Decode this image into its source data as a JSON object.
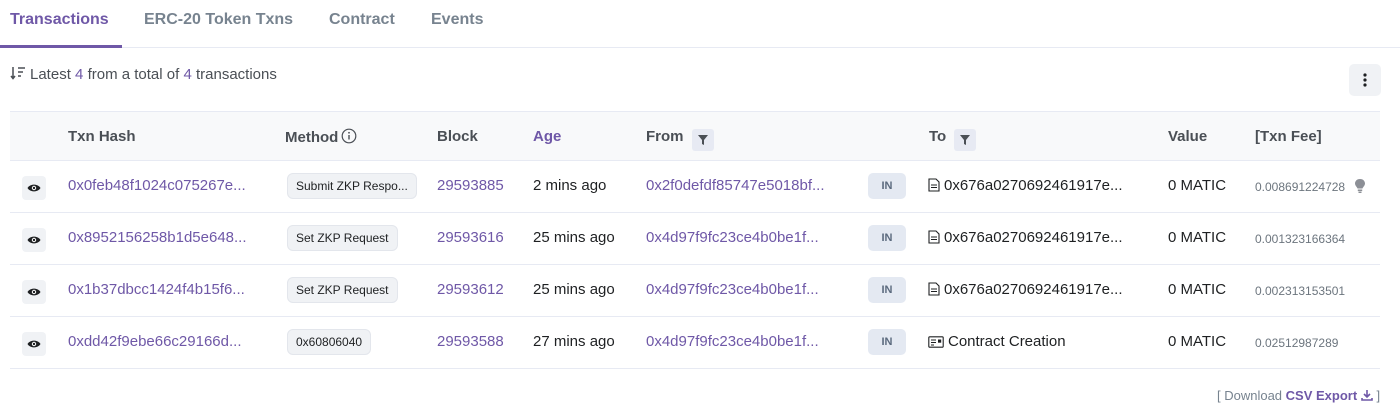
{
  "tabs": [
    {
      "label": "Transactions",
      "active": true
    },
    {
      "label": "ERC-20 Token Txns",
      "active": false
    },
    {
      "label": "Contract",
      "active": false
    },
    {
      "label": "Events",
      "active": false
    }
  ],
  "summary": {
    "prefix": "Latest",
    "count": "4",
    "middle": "from a total of",
    "total": "4",
    "suffix": "transactions"
  },
  "table": {
    "headers": {
      "txn_hash": "Txn Hash",
      "method": "Method",
      "block": "Block",
      "age": "Age",
      "from": "From",
      "to": "To",
      "value": "Value",
      "fee": "[Txn Fee]"
    },
    "rows": [
      {
        "hash": "0x0feb48f1024c075267e...",
        "method": "Submit ZKP Respo...",
        "block": "29593885",
        "age": "2 mins ago",
        "from": "0x2f0defdf85747e5018bf...",
        "direction": "IN",
        "to": "0x676a0270692461917e...",
        "to_icon": "document-icon",
        "value": "0 MATIC",
        "fee": "0.008691224728",
        "has_gas_icon": true
      },
      {
        "hash": "0x8952156258b1d5e648...",
        "method": "Set ZKP Request",
        "block": "29593616",
        "age": "25 mins ago",
        "from": "0x4d97f9fc23ce4b0be1f...",
        "direction": "IN",
        "to": "0x676a0270692461917e...",
        "to_icon": "document-icon",
        "value": "0 MATIC",
        "fee": "0.001323166364",
        "has_gas_icon": false
      },
      {
        "hash": "0x1b37dbcc1424f4b15f6...",
        "method": "Set ZKP Request",
        "block": "29593612",
        "age": "25 mins ago",
        "from": "0x4d97f9fc23ce4b0be1f...",
        "direction": "IN",
        "to": "0x676a0270692461917e...",
        "to_icon": "document-icon",
        "value": "0 MATIC",
        "fee": "0.002313153501",
        "has_gas_icon": false
      },
      {
        "hash": "0xdd42f9ebe66c29166d...",
        "method": "0x60806040",
        "block": "29593588",
        "age": "27 mins ago",
        "from": "0x4d97f9fc23ce4b0be1f...",
        "direction": "IN",
        "to": "Contract Creation",
        "to_icon": "contract-creation-icon",
        "value": "0 MATIC",
        "fee": "0.02512987289",
        "has_gas_icon": false
      }
    ]
  },
  "footer": {
    "open": "[ Download",
    "csv": "CSV Export",
    "close": "]"
  },
  "colors": {
    "accent": "#6f58a7",
    "text": "#1e2022",
    "muted": "#77838f"
  }
}
